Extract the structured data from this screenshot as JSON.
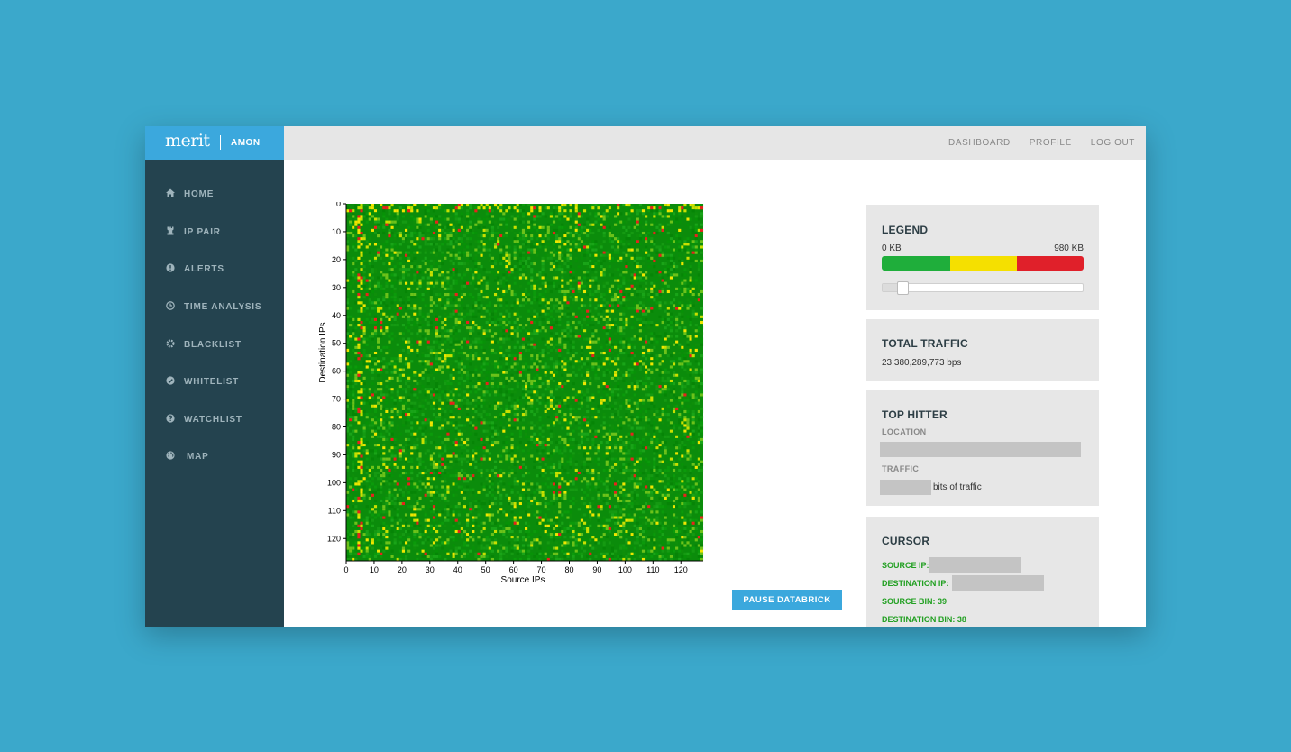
{
  "brand": {
    "logo": "merit",
    "app": "AMON"
  },
  "topnav": [
    "DASHBOARD",
    "PROFILE",
    "LOG OUT"
  ],
  "sidebar": {
    "items": [
      {
        "label": "HOME",
        "icon": "home-icon"
      },
      {
        "label": "IP PAIR",
        "icon": "chess-rook-icon"
      },
      {
        "label": "ALERTS",
        "icon": "alert-icon"
      },
      {
        "label": "TIME ANALYSIS",
        "icon": "clock-icon"
      },
      {
        "label": "BLACKLIST",
        "icon": "gear-icon"
      },
      {
        "label": "WHITELIST",
        "icon": "check-circle-icon"
      },
      {
        "label": "WATCHLIST",
        "icon": "question-icon"
      },
      {
        "label": "MAP",
        "icon": "globe-icon"
      }
    ]
  },
  "chart_data": {
    "type": "heatmap",
    "xlabel": "Source IPs",
    "ylabel": "Destination IPs",
    "xlim": [
      0,
      128
    ],
    "ylim": [
      0,
      128
    ],
    "x_ticks": [
      0,
      10,
      20,
      30,
      40,
      50,
      60,
      70,
      80,
      90,
      100,
      110,
      120
    ],
    "y_ticks": [
      0,
      10,
      20,
      30,
      40,
      50,
      60,
      70,
      80,
      90,
      100,
      110,
      120
    ],
    "color_scale": [
      "#0a8f0a",
      "#ffe100",
      "#e51c1c"
    ],
    "note": "128x128 grid of traffic volume per source/destination bin; mostly low (green) with sparse yellow/red cells"
  },
  "pause_button": "PAUSE DATABRICK",
  "legend": {
    "title": "LEGEND",
    "min_label": "0 KB",
    "max_label": "980 KB",
    "colors": [
      "#1fae3b",
      "#f5e000",
      "#e0202a"
    ],
    "slider_value": 0.1
  },
  "total_traffic": {
    "title": "TOTAL TRAFFIC",
    "value": "23,380,289,773 bps"
  },
  "top_hitter": {
    "title": "TOP HITTER",
    "location_label": "LOCATION",
    "traffic_label": "TRAFFIC",
    "traffic_suffix": "bits of traffic"
  },
  "cursor": {
    "title": "CURSOR",
    "source_ip_label": "SOURCE IP:",
    "destination_ip_label": "DESTINATION IP:",
    "source_bin": "SOURCE BIN: 39",
    "destination_bin": "DESTINATION BIN: 38"
  }
}
